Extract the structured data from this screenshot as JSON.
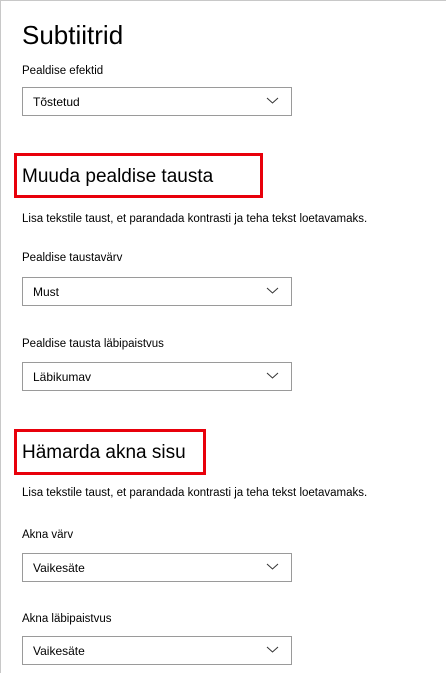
{
  "page": {
    "title": "Subtiitrid"
  },
  "caption_effects": {
    "label": "Pealdise efektid",
    "value": "Tõstetud"
  },
  "caption_background": {
    "heading": "Muuda pealdise tausta",
    "description": "Lisa tekstile taust, et parandada kontrasti ja teha tekst loetavamaks.",
    "color": {
      "label": "Pealdise taustavärv",
      "value": "Must"
    },
    "transparency": {
      "label": "Pealdise tausta läbipaistvus",
      "value": "Läbikumav"
    }
  },
  "window_dim": {
    "heading": "Hämarda akna sisu",
    "description": "Lisa tekstile taust, et parandada kontrasti ja teha tekst loetavamaks.",
    "color": {
      "label": "Akna värv",
      "value": "Vaikesäte"
    },
    "transparency": {
      "label": "Akna läbipaistvus",
      "value": "Vaikesäte"
    }
  },
  "colors": {
    "highlight": "#e8000b",
    "border": "#9a9a9a"
  },
  "icons": {
    "dropdown": "chevron-down-icon"
  }
}
